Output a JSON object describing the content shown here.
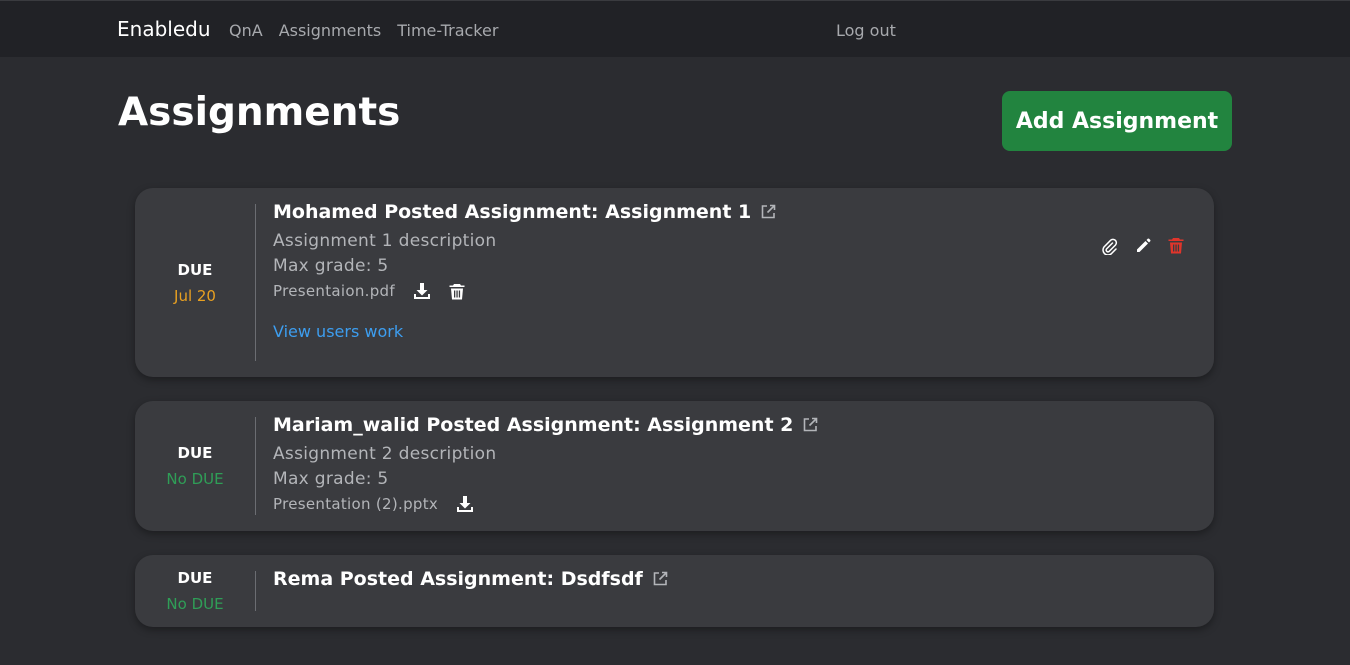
{
  "nav": {
    "brand": "Enabledu",
    "links": [
      "QnA",
      "Assignments",
      "Time-Tracker"
    ],
    "logout": "Log out"
  },
  "page": {
    "title": "Assignments",
    "add_button": "Add Assignment"
  },
  "assignments": [
    {
      "due_label": "DUE",
      "due_date": "Jul 20",
      "title": "Mohamed Posted Assignment: Assignment 1",
      "description": "Assignment 1 description",
      "max_grade": "Max grade: 5",
      "file": "Presentaion.pdf",
      "view_link": "View users work"
    },
    {
      "due_label": "DUE",
      "due_date": "No DUE",
      "title": "Mariam_walid Posted Assignment: Assignment 2",
      "description": "Assignment 2 description",
      "max_grade": "Max grade: 5",
      "file": "Presentation (2).pptx"
    },
    {
      "due_label": "DUE",
      "due_date": "No DUE",
      "title": "Rema Posted Assignment: Dsdfsdf"
    }
  ],
  "colors": {
    "background": "#2b2c30",
    "navbar": "#212226",
    "card": "#3a3b3f",
    "accent_green": "#22843f",
    "due_orange": "#e8a021",
    "due_green": "#2f9e57",
    "link_blue": "#3d9ef0",
    "delete_red": "#e0352b"
  }
}
